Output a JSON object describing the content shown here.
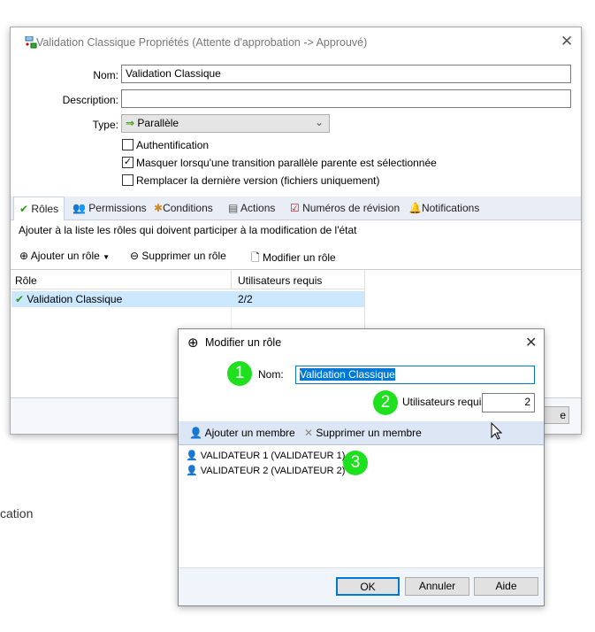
{
  "main_dialog": {
    "title": "Validation Classique Propriétés (Attente d'approbation -> Approuvé)",
    "name_label": "Nom:",
    "name_value": "Validation Classique",
    "description_label": "Description:",
    "description_value": "",
    "type_label": "Type:",
    "type_value": "Parallèle",
    "checkboxes": [
      {
        "label": "Authentification",
        "checked": false
      },
      {
        "label": "Masquer lorsqu'une transition parallèle parente est sélectionnée",
        "checked": true
      },
      {
        "label": "Remplacer la dernière version (fichiers uniquement)",
        "checked": false
      }
    ],
    "tabs": [
      "Rôles",
      "Permissions",
      "Conditions",
      "Actions",
      "Numéros de révision",
      "Notifications"
    ],
    "roles_hint": "Ajouter à la liste les rôles qui doivent participer à la modification de l'état",
    "toolbar": {
      "add": "Ajouter un rôle",
      "remove": "Supprimer un rôle",
      "edit": "Modifier un rôle"
    },
    "table": {
      "headers": [
        "Rôle",
        "Utilisateurs requis"
      ],
      "rows": [
        {
          "role": "Validation Classique",
          "required": "2/2"
        }
      ]
    },
    "partial_button": "e"
  },
  "background_text": "cation",
  "edit_role_dialog": {
    "title": "Modifier un rôle",
    "name_label": "Nom:",
    "name_value": "Validation Classique",
    "required_label": "Utilisateurs requis",
    "required_value": "2",
    "toolbar": {
      "add_member": "Ajouter un membre",
      "remove_member": "Supprimer un membre"
    },
    "members": [
      "VALIDATEUR 1 (VALIDATEUR 1)",
      "VALIDATEUR 2 (VALIDATEUR 2)"
    ],
    "buttons": {
      "ok": "OK",
      "cancel": "Annuler",
      "help": "Aide"
    }
  },
  "badges": [
    "1",
    "2",
    "3"
  ],
  "colors": {
    "badge": "#1ee01e",
    "selection": "#cce8ff",
    "accent": "#0078d7",
    "tabstrip": "#e9eef6"
  }
}
